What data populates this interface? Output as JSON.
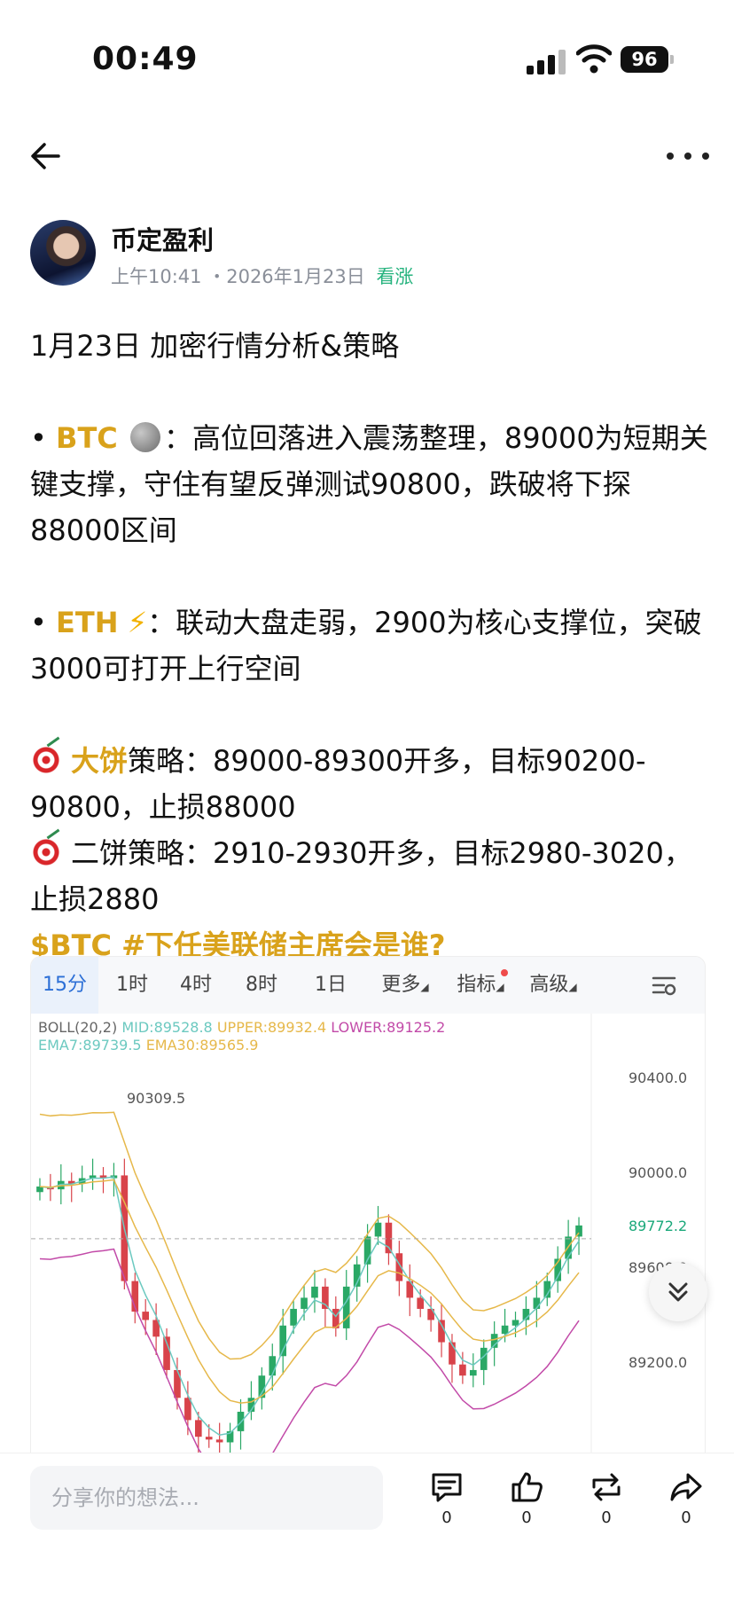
{
  "status_bar": {
    "time": "00:49",
    "battery": "96"
  },
  "post": {
    "author": "币定盈利",
    "time": "上午10:41",
    "date": "・2026年1月23日",
    "sentiment": "看涨",
    "title": "1月23日 加密行情分析&策略",
    "btc_bullet": "•",
    "btc_label": "BTC",
    "btc_text": "：高位回落进入震荡整理，89000为短期关键支撑，守住有望反弹测试90800，跌破将下探88000区间",
    "eth_bullet": "•",
    "eth_label": "ETH",
    "eth_text": "：联动大盘走弱，2900为核心支撑位，突破3000可打开上行空间",
    "strategy1_highlight": "大饼",
    "strategy1_text": "策略：89000-89300开多，目标90200-90800，止损88000",
    "strategy2_text": "二饼策略：2910-2930开多，目标2980-3020，止损2880",
    "hashtags": "$BTC #下任美联储主席会是谁?"
  },
  "chart": {
    "tabs": [
      "15分",
      "1时",
      "4时",
      "8时",
      "1日",
      "更多",
      "指标",
      "高级"
    ],
    "active_tab": "15分",
    "legend": {
      "boll": "BOLL(20,2)",
      "mid": "MID:89528.8",
      "upper": "UPPER:89932.4",
      "lower": "LOWER:89125.2",
      "ema7": "EMA7:89739.5",
      "ema30": "EMA30:89565.9"
    },
    "high_label": "90309.5",
    "price_axis": [
      "90400.0",
      "90000.0",
      "89600.0",
      "89200.0"
    ],
    "current_price": "89772.2",
    "colors": {
      "up": "#2aa866",
      "down": "#d8434a",
      "upper": "#e6b84a",
      "mid": "#e6b84a",
      "lower": "#c24aa8",
      "ema7": "#6cc9c0",
      "ema30": "#e6b84a"
    }
  },
  "chart_data": {
    "type": "candlestick",
    "indicator": "BOLL(20,2)",
    "ylim": [
      89000,
      90550
    ],
    "y_ticks": [
      90400.0,
      90000.0,
      89600.0,
      89200.0
    ],
    "annotations": [
      "90309.5",
      "89772.2"
    ],
    "series": [
      {
        "name": "MID",
        "last": 89528.8
      },
      {
        "name": "UPPER",
        "last": 89932.4
      },
      {
        "name": "LOWER",
        "last": 89125.2
      },
      {
        "name": "EMA7",
        "last": 89739.5
      },
      {
        "name": "EMA30",
        "last": 89565.9
      }
    ]
  },
  "bottom": {
    "input_placeholder": "分享你的想法...",
    "comment_count": "0",
    "like_count": "0",
    "repost_count": "0",
    "share_count": "0"
  }
}
